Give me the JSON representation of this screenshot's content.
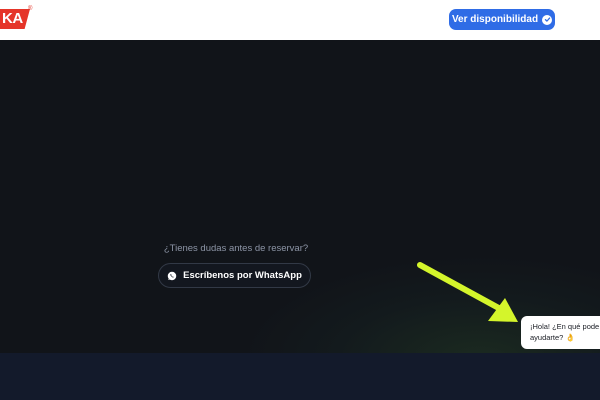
{
  "header": {
    "logo_text": "KA",
    "logo_reg": "®",
    "cta_label": "Ver disponibilidad",
    "cta_icon": "check-circle-icon"
  },
  "hero": {
    "question": "¿Tienes dudas antes de reservar?",
    "whatsapp_label": "Escríbenos por WhatsApp",
    "whatsapp_icon": "whatsapp-icon"
  },
  "chat_bubble": {
    "line1": "¡Hola! ¿En qué pode",
    "line2": "ayudarte? 👌"
  },
  "colors": {
    "brand_red": "#e53529",
    "cta_blue": "#2f6ce6",
    "arrow_lime": "#d4f52b",
    "hero_bg": "#111419",
    "bottom_bg": "#131a2b"
  }
}
